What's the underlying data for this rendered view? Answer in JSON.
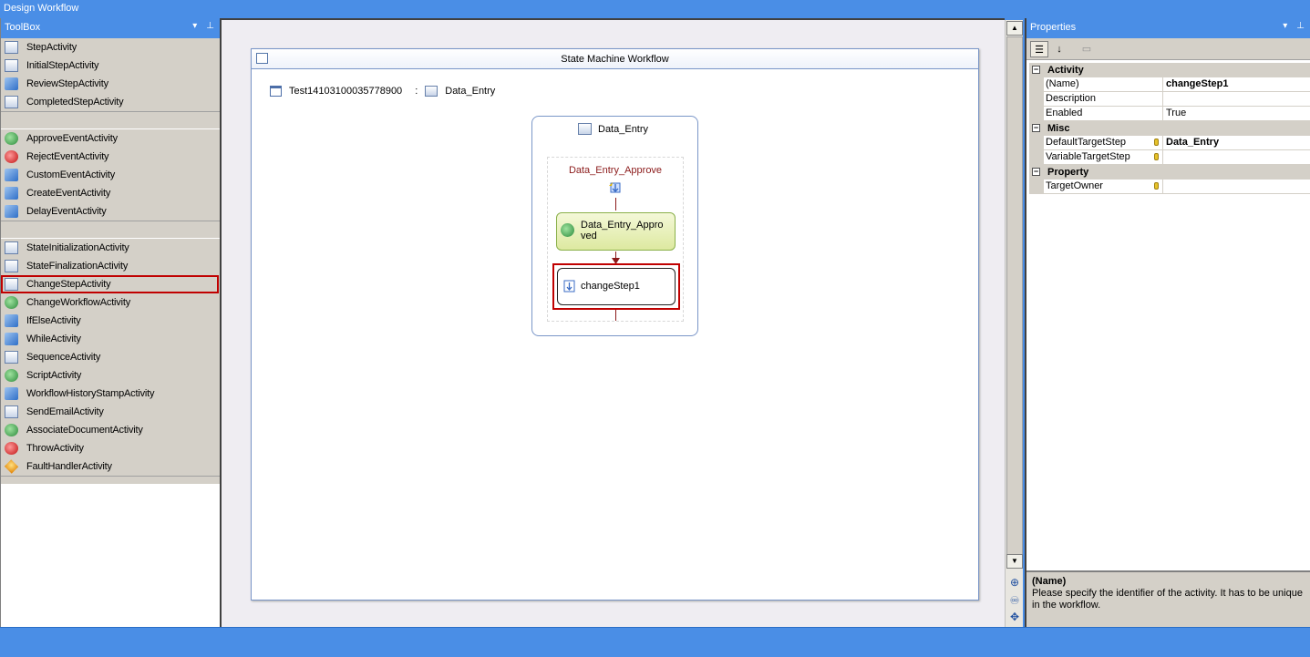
{
  "window": {
    "title": "Design Workflow"
  },
  "toolbox": {
    "title": "ToolBox",
    "pin_glyph": "▾",
    "pin2_glyph": "⨼",
    "groups": [
      [
        "StepActivity",
        "InitialStepActivity",
        "ReviewStepActivity",
        "CompletedStepActivity"
      ],
      [
        "ApproveEventActivity",
        "RejectEventActivity",
        "CustomEventActivity",
        "CreateEventActivity",
        "DelayEventActivity"
      ],
      [
        "StateInitializationActivity",
        "StateFinalizationActivity",
        "ChangeStepActivity",
        "ChangeWorkflowActivity",
        "IfElseActivity",
        "WhileActivity",
        "SequenceActivity",
        "ScriptActivity",
        "WorkflowHistoryStampActivity",
        "SendEmailActivity",
        "AssociateDocumentActivity",
        "ThrowActivity",
        "FaultHandlerActivity"
      ]
    ],
    "selected": "ChangeStepActivity"
  },
  "designer": {
    "frame_title": "State Machine Workflow",
    "root_name": "Test14103100035778900",
    "root_sep": ":",
    "initial_state": "Data_Entry",
    "state": {
      "title": "Data_Entry",
      "event_title": "Data_Entry_Approve",
      "approved_label": "Data_Entry_Appro ved",
      "change_label": "changeStep1"
    }
  },
  "properties": {
    "title": "Properties",
    "categories": [
      {
        "name": "Activity",
        "rows": [
          {
            "name": "(Name)",
            "value": "changeStep1",
            "bold": true
          },
          {
            "name": "Description",
            "value": ""
          },
          {
            "name": "Enabled",
            "value": "True"
          }
        ]
      },
      {
        "name": "Misc",
        "rows": [
          {
            "name": "DefaultTargetStep",
            "value": "Data_Entry",
            "bold": true,
            "lock": true
          },
          {
            "name": "VariableTargetStep",
            "value": "",
            "lock": true
          }
        ]
      },
      {
        "name": "Property",
        "rows": [
          {
            "name": "TargetOwner",
            "value": "",
            "lock": true
          }
        ]
      }
    ],
    "description": {
      "title": "(Name)",
      "text": "Please specify the identifier of the activity. It has to be unique in the workflow."
    }
  }
}
